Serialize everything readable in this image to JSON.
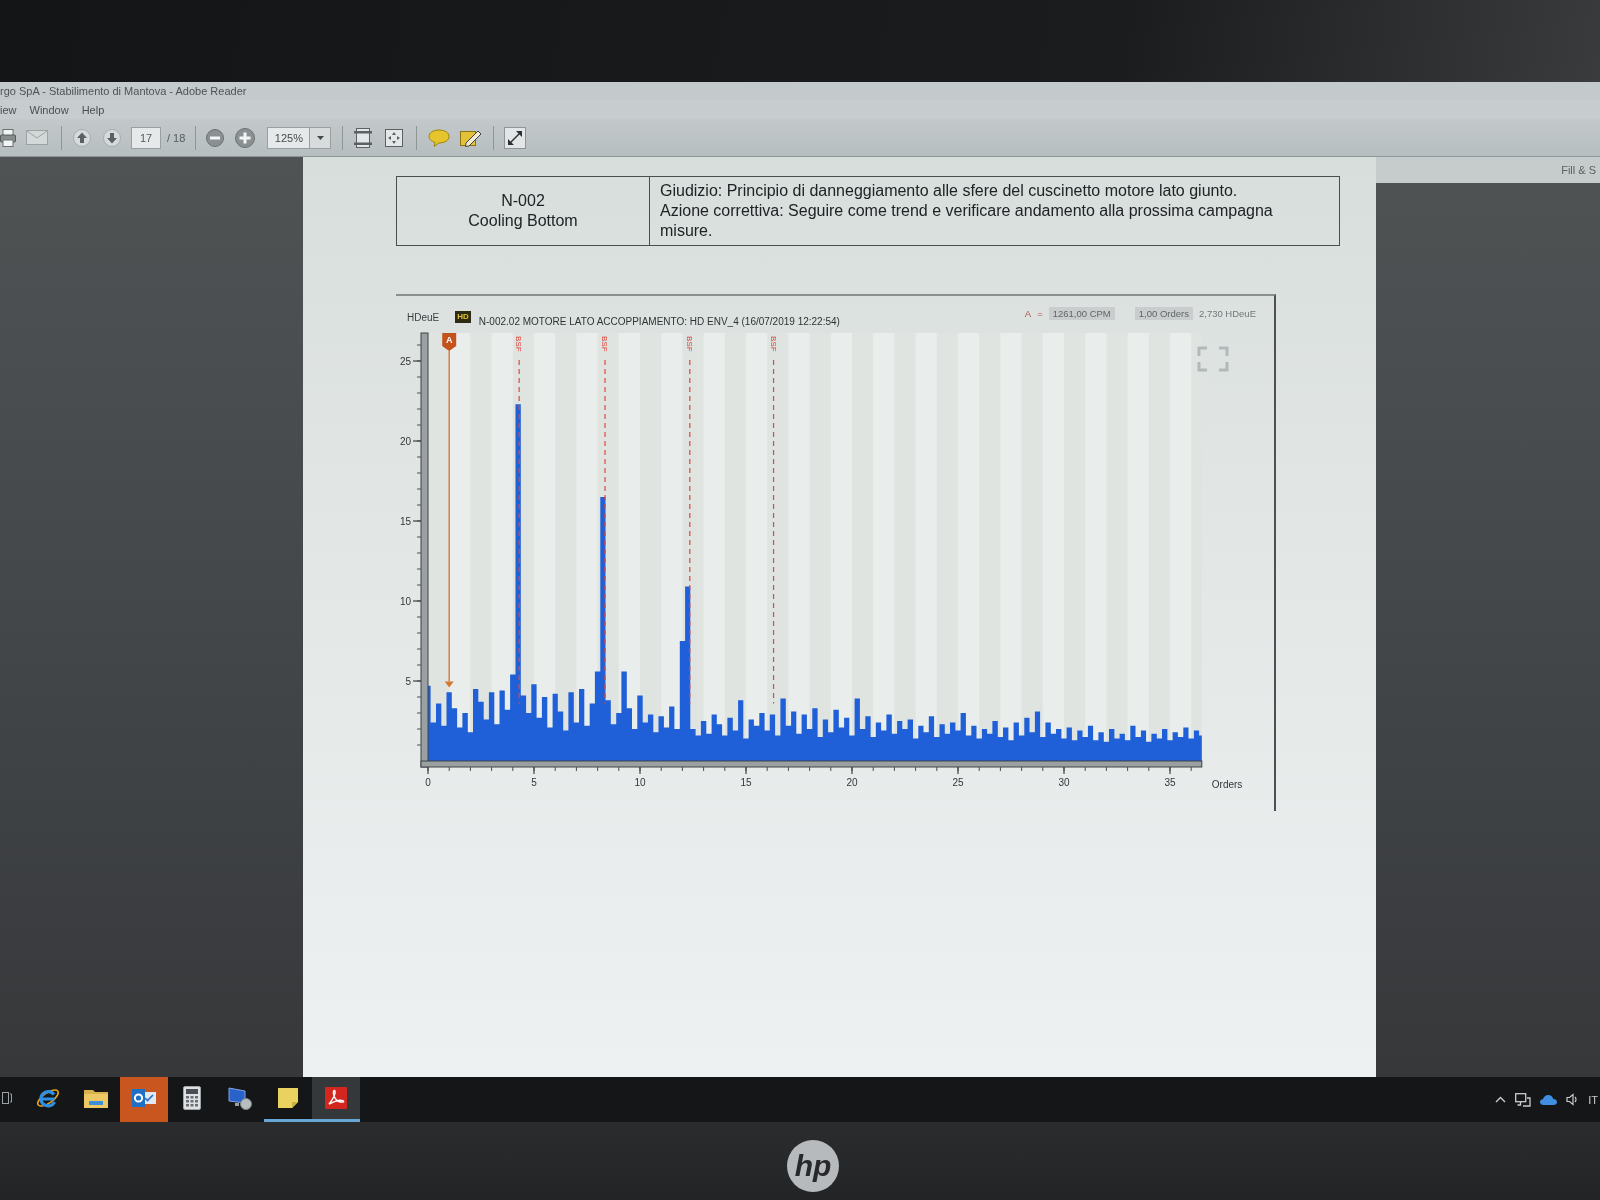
{
  "window": {
    "title": "rgo SpA - Stabilimento di Mantova - Adobe Reader"
  },
  "menu": [
    "iew",
    "Window",
    "Help"
  ],
  "toolbar": {
    "page_field": {
      "value": "17"
    },
    "page_count": "/ 18",
    "zoom_field": {
      "value": "125%"
    }
  },
  "side_panel": {
    "header": "Fill & S"
  },
  "document": {
    "table": {
      "rows": [
        {
          "asset": [
            "N-002",
            "Cooling Bottom"
          ],
          "notes": [
            "Giudizio: Principio di danneggiamento alle sfere del cuscinetto motore lato giunto.",
            "Azione correttiva: Seguire come trend e verificare andamento alla prossima campagna misure."
          ]
        }
      ]
    },
    "chart": {
      "badge": "HD",
      "readout": {
        "cursor": "A",
        "equals": "=",
        "frequency": "1261,00 CPM",
        "order": "1,00 Orders",
        "amplitude": "2,730 HDeuE"
      },
      "chart_data": {
        "type": "area",
        "title": "N-002.02 MOTORE LATO ACCOPPIAMENTO: HD ENV_4 (16/07/2019 12:22:54)",
        "xlabel": "Orders",
        "ylabel": "HDeuE",
        "x": [
          0,
          0.25,
          0.5,
          0.75,
          1,
          1.25,
          1.5,
          1.75,
          2,
          2.25,
          2.5,
          2.75,
          3,
          3.25,
          3.5,
          3.75,
          4,
          4.25,
          4.5,
          4.75,
          5,
          5.25,
          5.5,
          5.75,
          6,
          6.25,
          6.5,
          6.75,
          7,
          7.25,
          7.5,
          7.75,
          8,
          8.25,
          8.5,
          8.75,
          9,
          9.25,
          9.5,
          9.75,
          10,
          10.25,
          10.5,
          10.75,
          11,
          11.25,
          11.5,
          11.75,
          12,
          12.25,
          12.5,
          12.75,
          13,
          13.25,
          13.5,
          13.75,
          14,
          14.25,
          14.5,
          14.75,
          15,
          15.25,
          15.5,
          15.75,
          16,
          16.25,
          16.5,
          16.75,
          17,
          17.25,
          17.5,
          17.75,
          18,
          18.25,
          18.5,
          18.75,
          19,
          19.25,
          19.5,
          19.75,
          20,
          20.25,
          20.5,
          20.75,
          21,
          21.25,
          21.5,
          21.75,
          22,
          22.25,
          22.5,
          22.75,
          23,
          23.25,
          23.5,
          23.75,
          24,
          24.25,
          24.5,
          24.75,
          25,
          25.25,
          25.5,
          25.75,
          26,
          26.25,
          26.5,
          26.75,
          27,
          27.25,
          27.5,
          27.75,
          28,
          28.25,
          28.5,
          28.75,
          29,
          29.25,
          29.5,
          29.75,
          30,
          30.25,
          30.5,
          30.75,
          31,
          31.25,
          31.5,
          31.75,
          32,
          32.25,
          32.5,
          32.75,
          33,
          33.25,
          33.5,
          33.75,
          34,
          34.25,
          34.5,
          34.75,
          35,
          35.25,
          35.5,
          35.75,
          36,
          36.25,
          36.5
        ],
        "series": [
          {
            "color": "#1f5fd8",
            "values": [
              4.7,
              2.4,
              3.6,
              2.2,
              4.3,
              3.3,
              2.1,
              3.0,
              1.8,
              4.5,
              3.7,
              2.6,
              4.3,
              2.3,
              4.4,
              3.2,
              5.4,
              22.3,
              4.1,
              3.0,
              4.8,
              2.7,
              4.0,
              2.1,
              4.2,
              3.1,
              1.9,
              4.3,
              2.4,
              4.5,
              2.2,
              3.6,
              5.6,
              16.5,
              3.8,
              2.3,
              3.0,
              5.6,
              3.3,
              2.0,
              4.1,
              2.4,
              2.9,
              1.8,
              2.8,
              2.1,
              3.4,
              2.0,
              7.5,
              10.9,
              2.0,
              1.6,
              2.5,
              1.7,
              2.9,
              2.3,
              1.6,
              2.7,
              1.9,
              3.8,
              1.4,
              2.6,
              2.2,
              3.0,
              1.9,
              2.9,
              1.6,
              3.9,
              2.2,
              3.1,
              1.7,
              2.9,
              2.0,
              3.3,
              1.5,
              2.6,
              1.8,
              3.2,
              2.1,
              2.7,
              1.6,
              3.9,
              2.0,
              2.8,
              1.5,
              2.4,
              1.9,
              2.9,
              1.7,
              2.5,
              2.0,
              2.6,
              1.4,
              2.2,
              1.8,
              2.8,
              1.5,
              2.3,
              1.7,
              2.4,
              1.9,
              3.0,
              1.6,
              2.2,
              1.4,
              2.0,
              1.7,
              2.5,
              1.5,
              2.1,
              1.3,
              2.4,
              1.6,
              2.7,
              1.8,
              3.1,
              1.5,
              2.4,
              1.7,
              2.0,
              1.4,
              2.1,
              1.3,
              1.9,
              1.5,
              2.2,
              1.3,
              1.8,
              1.2,
              2.0,
              1.4,
              1.7,
              1.3,
              2.2,
              1.5,
              1.9,
              1.2,
              1.7,
              1.4,
              2.0,
              1.3,
              1.8,
              1.5,
              2.1,
              1.4,
              1.9,
              1.6
            ]
          }
        ],
        "xlim": [
          0,
          36.5
        ],
        "ylim": [
          0,
          26.75
        ],
        "xticks": [
          0,
          5,
          10,
          15,
          20,
          25,
          30,
          35
        ],
        "yticks": [
          5,
          10,
          15,
          20,
          25
        ],
        "annotations": [
          {
            "text": "A",
            "x": 1.0,
            "y": 4.6
          }
        ],
        "ref_lines": [
          {
            "axis": "x",
            "value": 4.3,
            "label": "BSF"
          },
          {
            "axis": "x",
            "value": 8.35,
            "label": "BSF"
          },
          {
            "axis": "x",
            "value": 12.35,
            "label": "BSF"
          },
          {
            "axis": "x",
            "value": 16.3,
            "label": "BSF"
          }
        ]
      }
    }
  },
  "taskbar": {
    "apps": [
      {
        "kind": "task_view",
        "running": false,
        "selected": false,
        "flashing": false
      },
      {
        "kind": "browser",
        "running": false,
        "selected": false,
        "flashing": false
      },
      {
        "kind": "folder",
        "running": false,
        "selected": false,
        "flashing": false
      },
      {
        "kind": "mail",
        "running": false,
        "selected": false,
        "flashing": true
      },
      {
        "kind": "calculator",
        "running": false,
        "selected": false,
        "flashing": false
      },
      {
        "kind": "remote",
        "running": false,
        "selected": false,
        "flashing": false
      },
      {
        "kind": "note",
        "running": true,
        "selected": false,
        "flashing": false
      },
      {
        "kind": "pdf",
        "running": true,
        "selected": true,
        "flashing": false
      }
    ],
    "tray": {
      "language": "IT"
    }
  },
  "monitor": {
    "logo": "hp"
  }
}
